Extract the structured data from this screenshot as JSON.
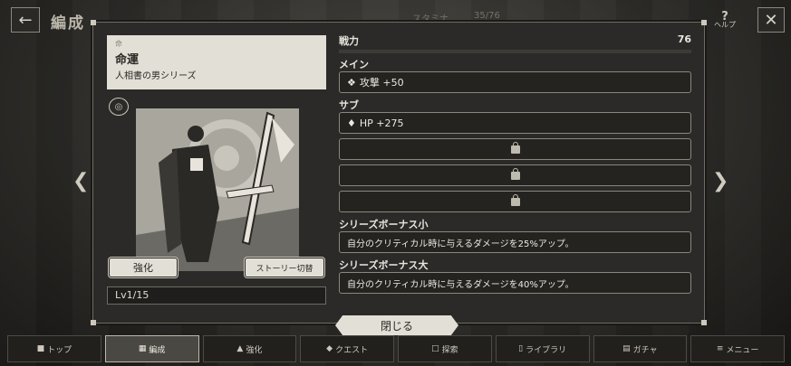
{
  "header": {
    "title": "編成",
    "stamina_label": "スタミナ",
    "stamina_value": "35/76",
    "help_label": "ヘルプ"
  },
  "card": {
    "small_label": "命",
    "name": "命運",
    "series": "人相書の男シリーズ",
    "strengthen_label": "強化",
    "story_label": "ストーリー切替",
    "level": "Lv1/15"
  },
  "stats": {
    "power_label": "戦力",
    "power_value": "76",
    "main_label": "メイン",
    "main_value": "攻撃 +50",
    "sub_label": "サブ",
    "sub_value": "HP +275",
    "bonus_small_label": "シリーズボーナス小",
    "bonus_small_text": "自分のクリティカル時に与えるダメージを25%アップ。",
    "bonus_large_label": "シリーズボーナス大",
    "bonus_large_text": "自分のクリティカル時に与えるダメージを40%アップ。"
  },
  "close_label": "閉じる",
  "nav": [
    {
      "label": "トップ",
      "icon": "home-icon"
    },
    {
      "label": "編成",
      "icon": "formation-icon",
      "active": true
    },
    {
      "label": "強化",
      "icon": "strengthen-icon"
    },
    {
      "label": "クエスト",
      "icon": "quest-icon"
    },
    {
      "label": "探索",
      "icon": "explore-icon"
    },
    {
      "label": "ライブラリ",
      "icon": "library-icon"
    },
    {
      "label": "ガチャ",
      "icon": "gacha-icon"
    },
    {
      "label": "メニュー",
      "icon": "menu-icon"
    }
  ]
}
